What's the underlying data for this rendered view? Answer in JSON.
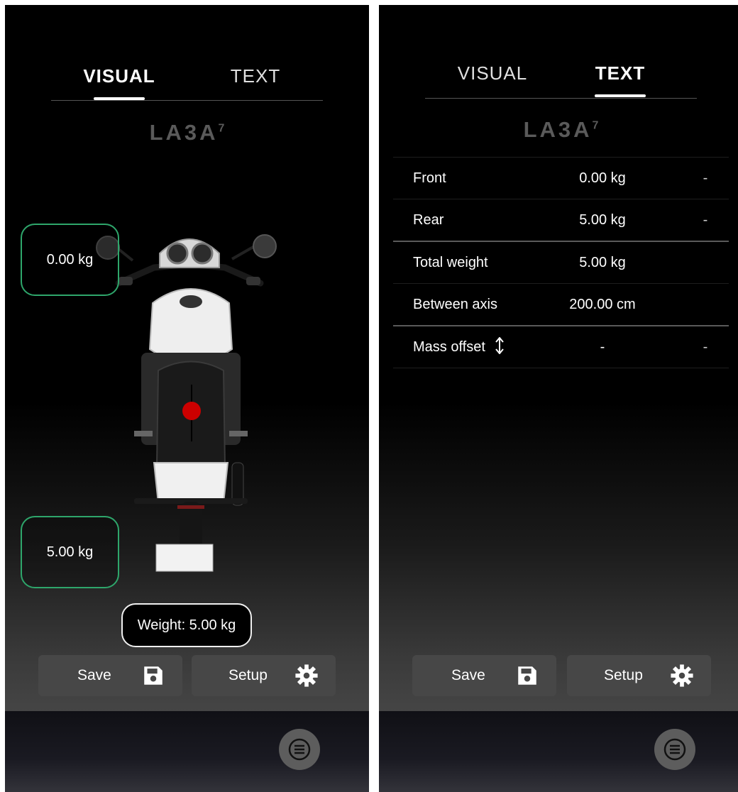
{
  "tabs": {
    "visual": "VISUAL",
    "text": "TEXT"
  },
  "logo": {
    "main": "LA3A",
    "sup": "7"
  },
  "visual": {
    "front_weight": "0.00 kg",
    "rear_weight": "5.00 kg",
    "weight_pill": "Weight: 5.00 kg"
  },
  "text_view": {
    "rows": [
      {
        "label": "Front",
        "value": "0.00 kg",
        "extra": "-"
      },
      {
        "label": "Rear",
        "value": "5.00 kg",
        "extra": "-"
      },
      {
        "label": "Total weight",
        "value": "5.00 kg",
        "extra": ""
      },
      {
        "label": "Between axis",
        "value": "200.00 cm",
        "extra": ""
      },
      {
        "label": "Mass offset",
        "value": "-",
        "extra": "-"
      }
    ]
  },
  "buttons": {
    "save": "Save",
    "setup": "Setup"
  },
  "colors": {
    "accent_border": "#2ea66b",
    "center_of_mass": "#cc0000",
    "button_bg": "#474747"
  }
}
